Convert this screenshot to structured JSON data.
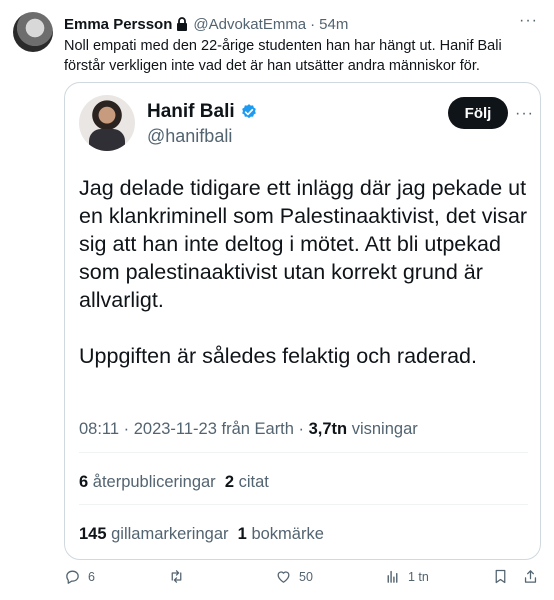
{
  "tweet": {
    "author_name": "Emma Persson",
    "handle": "@AdvokatEmma",
    "separator": "·",
    "time": "54m",
    "more": "···",
    "text": "Noll empati med den 22-årige studenten han har hängt ut. Hanif Bali förstår verkligen inte vad det är han utsätter andra människor för."
  },
  "quote": {
    "name": "Hanif Bali",
    "handle": "@hanifbali",
    "follow_label": "Följ",
    "more": "···",
    "paragraph_1": "Jag delade tidigare ett inlägg där jag pekade ut en klankriminell som Palestinaaktivist, det visar sig att han inte deltog i mötet. Att bli utpekad som palestinaaktivist utan korrekt grund är allvarligt.",
    "paragraph_2": "Uppgiften är således felaktig och raderad.",
    "meta_time": "08:11 · 2023-11-23 från Earth · ",
    "meta_views_count": "3,7tn",
    "meta_views_label": " visningar",
    "reposts_count": "6",
    "reposts_label": " återpubliceringar",
    "quotes_count": "2",
    "quotes_label": " citat",
    "likes_count": "145",
    "likes_label": " gillamarkeringar",
    "bookmarks_count": "1",
    "bookmarks_label": " bokmärke"
  },
  "actions": {
    "replies": "6",
    "retweets": "",
    "likes": "50",
    "views": "1 tn"
  },
  "colors": {
    "text": "#0f1419",
    "secondary": "#536471",
    "verified": "#1d9bf0",
    "border": "#cfd9de"
  }
}
